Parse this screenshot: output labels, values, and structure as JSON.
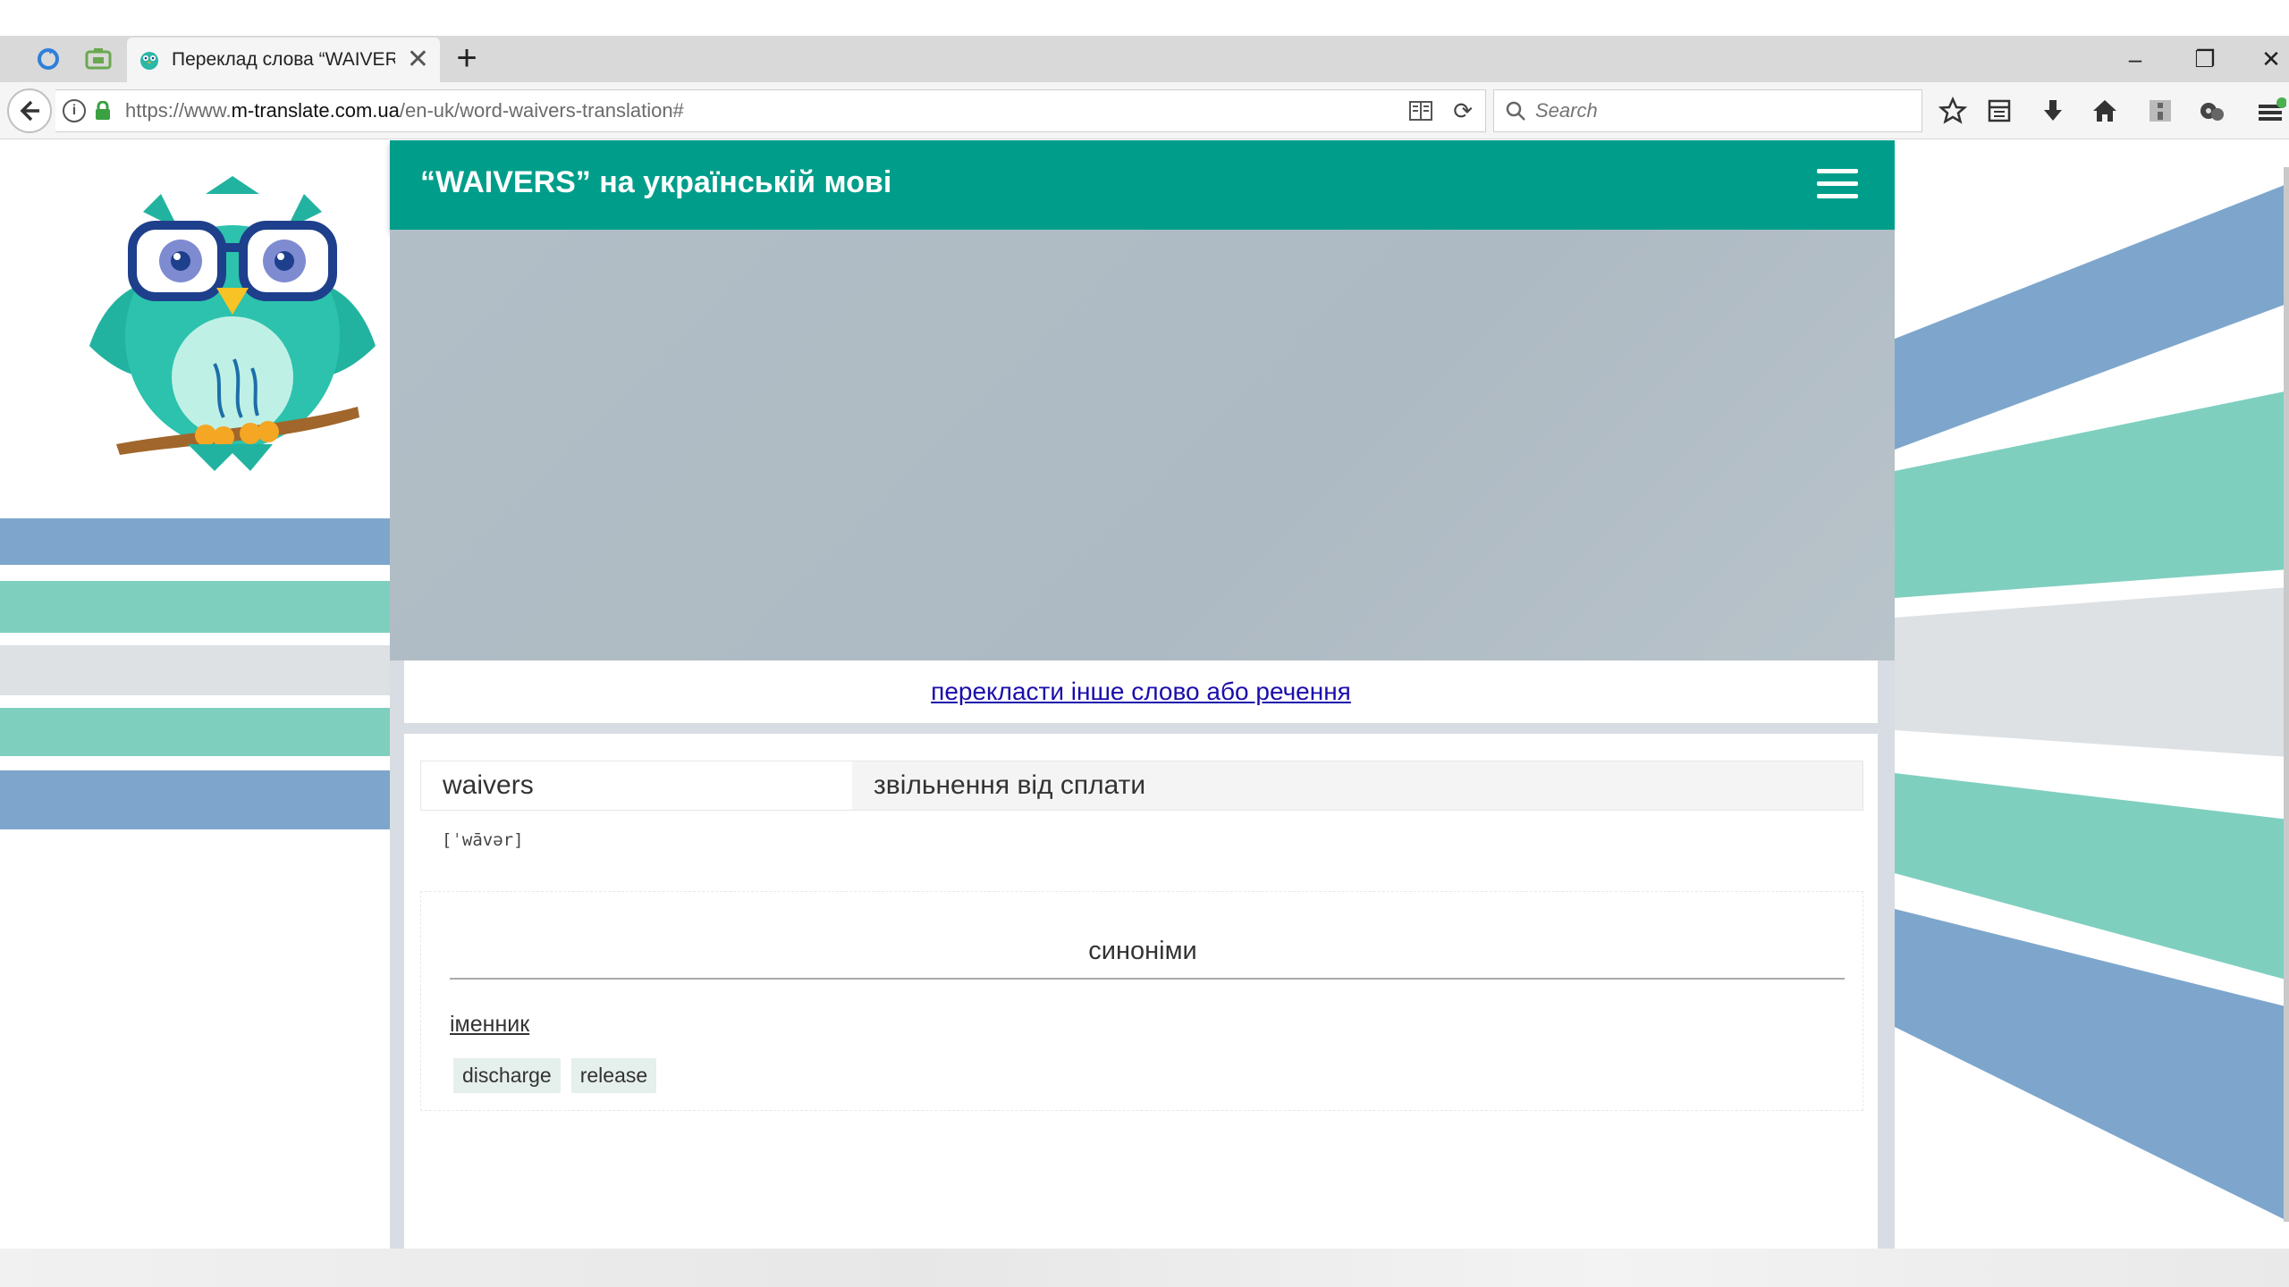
{
  "browser": {
    "tab_title": "Переклад слова “WAIVERS”",
    "url_prefix": "https://www.",
    "url_domain": "m-translate.com.ua",
    "url_path": "/en-uk/word-waivers-translation#",
    "search_placeholder": "Search",
    "new_tab": "+",
    "tab_close": "✕",
    "window_minimize": "–",
    "window_restore": "❐",
    "window_close": "✕"
  },
  "site": {
    "header_title": "“WAIVERS” на українській мові",
    "translate_other_link": "перекласти інше слово або речення",
    "word": "waivers",
    "translation": "звільнення від сплати",
    "transcription": "[ˈwāvər]",
    "synonyms_title": "синоніми",
    "part_of_speech": "іменник",
    "synonyms": [
      "discharge",
      "release"
    ]
  },
  "colors": {
    "header_teal": "#009e8a",
    "stripe_blue": "#7ea6cc",
    "stripe_teal": "#7fcfbf",
    "stripe_grey": "#dde1e4",
    "link_blue": "#1a0dab"
  },
  "icons": [
    "back-arrow-icon",
    "info-icon",
    "lock-icon",
    "reader-view-icon",
    "reload-icon",
    "search-icon",
    "bookmark-star-icon",
    "library-icon",
    "download-icon",
    "home-icon",
    "sidebar-icon",
    "extension-icon",
    "menu-icon",
    "owl-logo",
    "hamburger-menu-icon"
  ]
}
